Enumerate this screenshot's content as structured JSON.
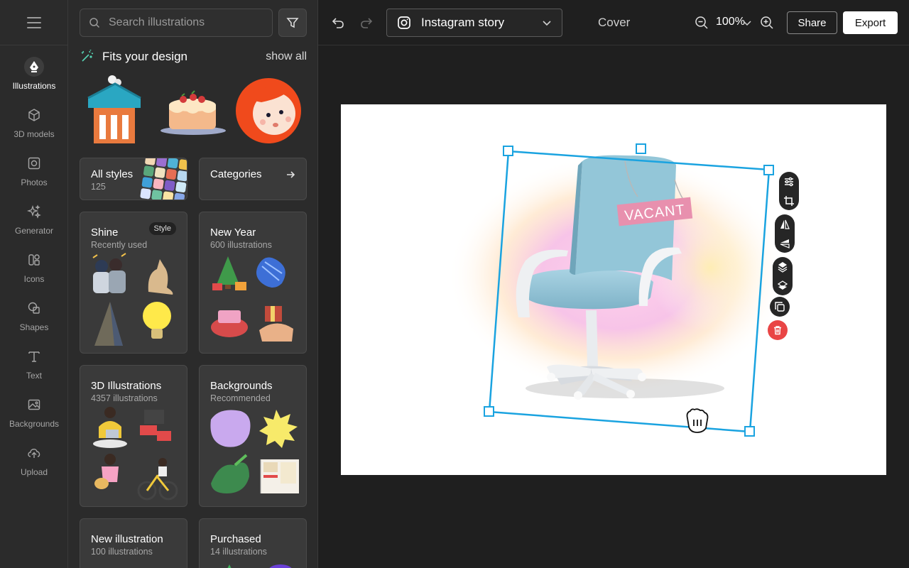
{
  "rail": {
    "items": [
      {
        "label": "Illustrations",
        "icon": "pen-nib-icon",
        "active": true
      },
      {
        "label": "3D models",
        "icon": "cube-icon"
      },
      {
        "label": "Photos",
        "icon": "photo-icon"
      },
      {
        "label": "Generator",
        "icon": "sparkles-icon"
      },
      {
        "label": "Icons",
        "icon": "icons-grid-icon"
      },
      {
        "label": "Shapes",
        "icon": "shapes-icon"
      },
      {
        "label": "Text",
        "icon": "text-icon"
      },
      {
        "label": "Backgrounds",
        "icon": "image-icon"
      },
      {
        "label": "Upload",
        "icon": "cloud-upload-icon"
      }
    ]
  },
  "panel": {
    "search_placeholder": "Search illustrations",
    "fits": {
      "title": "Fits your design",
      "show_all": "show all"
    },
    "cards": {
      "all_styles": {
        "title": "All styles",
        "sub": "125"
      },
      "categories": {
        "title": "Categories"
      },
      "shine": {
        "title": "Shine",
        "sub": "Recently used",
        "badge": "Style"
      },
      "new_year": {
        "title": "New Year",
        "sub": "600 illustrations"
      },
      "three_d": {
        "title": "3D Illustrations",
        "sub": "4357 illustrations"
      },
      "backgrounds": {
        "title": "Backgrounds",
        "sub": "Recommended"
      },
      "new_illustration": {
        "title": "New illustration",
        "sub": "100 illustrations"
      },
      "purchased": {
        "title": "Purchased",
        "sub": "14 illustrations"
      }
    }
  },
  "topbar": {
    "format": "Instagram story",
    "cover": "Cover",
    "zoom": "100%",
    "share": "Share",
    "export": "Export"
  },
  "canvas": {
    "sign_text": "VACANT"
  },
  "colors": {
    "accent_selection": "#1aa3e0",
    "delete_red": "#e94545",
    "chair_blue": "#8fc3d6"
  }
}
